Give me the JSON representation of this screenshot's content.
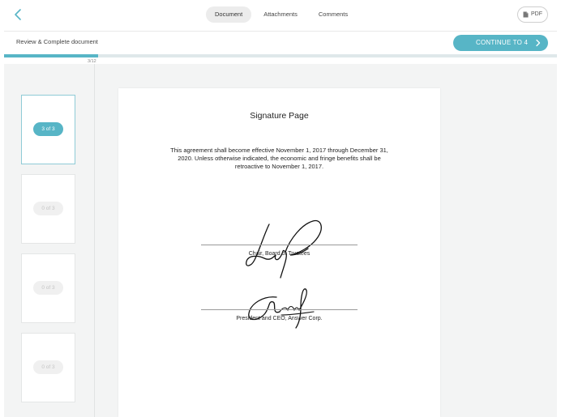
{
  "header": {
    "tabs": [
      {
        "label": "Document",
        "active": true
      },
      {
        "label": "Attachments",
        "active": false
      },
      {
        "label": "Comments",
        "active": false
      }
    ],
    "pdf_label": "PDF"
  },
  "review": {
    "title": "Review & Complete document",
    "continue_label": "CONTINUE TO 4"
  },
  "progress": {
    "label": "3/12",
    "value": 0.17
  },
  "thumbnails": [
    {
      "label": "3 of 3",
      "active": true
    },
    {
      "label": "0 of 3",
      "active": false
    },
    {
      "label": "0 of 3",
      "active": false
    },
    {
      "label": "0 of 3",
      "active": false
    }
  ],
  "document": {
    "title": "Signature Page",
    "body": "This agreement shall become effective November 1, 2017 through December 31, 2020. Unless otherwise indicated, the economic and fringe benefits shall be retroactive to November 1, 2017.",
    "signatures": [
      {
        "caption": "Chair, Board of Trustees"
      },
      {
        "caption": "President and CEO, Answer Corp."
      }
    ]
  },
  "colors": {
    "accent": "#57b5c6",
    "background": "#f3f4f4"
  },
  "icons": {
    "back": "chevron-left-icon",
    "pdf": "file-icon",
    "continue": "chevron-right-icon"
  }
}
